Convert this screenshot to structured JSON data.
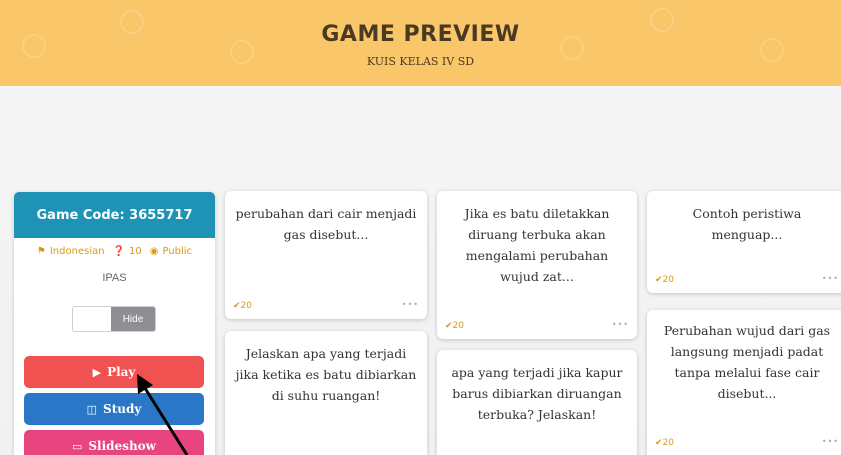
{
  "header": {
    "title": "Game Preview",
    "subtitle": "KUIS KELAS IV SD"
  },
  "panel": {
    "game_code": "Game Code: 3655717",
    "language": "Indonesian",
    "question_count": "10",
    "visibility": "Public",
    "subject": "IPAS",
    "toggle_label": "Hide",
    "play_label": "Play",
    "study_label": "Study",
    "slideshow_label": "Slideshow"
  },
  "cards": [
    {
      "text": "perubahan dari cair menjadi gas disebut...",
      "points": "20"
    },
    {
      "text": "Jelaskan apa yang terjadi jika ketika es batu dibiarkan di suhu ruangan!",
      "points": ""
    },
    {
      "text": "Jika es batu diletakkan diruang terbuka akan mengalami perubahan wujud zat...",
      "points": "20"
    },
    {
      "text": "apa yang terjadi jika kapur barus dibiarkan diruangan terbuka? Jelaskan!",
      "points": ""
    },
    {
      "text": "Contoh peristiwa menguap...",
      "points": "20"
    },
    {
      "text": "Perubahan wujud dari gas langsung menjadi padat tanpa melalui fase cair disebut...",
      "points": "20"
    }
  ],
  "colors": {
    "header_bg": "#f9c66a",
    "game_code_bg": "#1f93b5",
    "play": "#ef5250",
    "study": "#2a77c7",
    "slideshow": "#e74480",
    "accent": "#d89a18"
  },
  "icons": {
    "language": "flag-icon",
    "questions": "question-circle-icon",
    "visibility": "eye-icon",
    "play": "play-icon",
    "study": "book-icon",
    "slideshow": "monitor-icon",
    "points": "check-icon",
    "more": "ellipsis-icon"
  }
}
